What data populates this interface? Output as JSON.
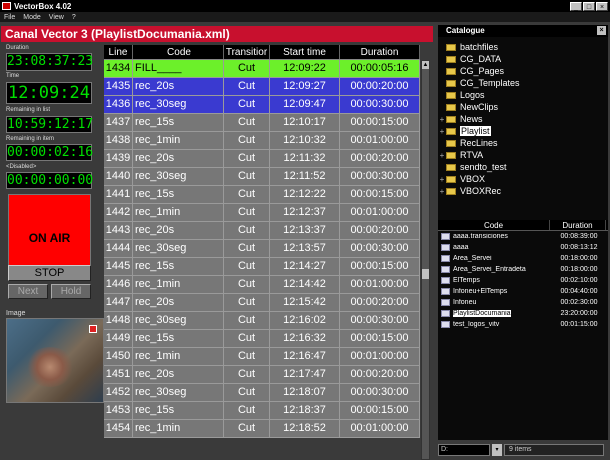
{
  "window": {
    "title": "VectorBox 4.02",
    "min": "_",
    "max": "□",
    "close": "×"
  },
  "menu": [
    "File",
    "Mode",
    "View",
    "?"
  ],
  "left": {
    "duration_label": "Duration",
    "duration": "23:08:37:23",
    "time_label": "Time",
    "time": "12:09:24",
    "remaining_list_label": "Remaining in list",
    "remaining_list": "10:59:12:17",
    "remaining_item_label": "Remaining in item",
    "remaining_item": "00:00:02:16",
    "disabled_label": "<Disabled>",
    "disabled": "00:00:00:00",
    "on_air": "ON AIR",
    "stop": "STOP",
    "next": "Next",
    "hold": "Hold",
    "image_label": "Image"
  },
  "playlist": {
    "title": "Canal Vector 3  (PlaylistDocumania.xml)",
    "columns": [
      "Line",
      "Code",
      "Transitior",
      "Start time",
      "Duration"
    ],
    "rows": [
      {
        "line": "1434",
        "code": "FILL____",
        "trans": "Cut",
        "start": "12:09:22",
        "dur": "00:00:05:16",
        "state": "current"
      },
      {
        "line": "1435",
        "code": "rec_20s",
        "trans": "Cut",
        "start": "12:09:27",
        "dur": "00:00:20:00",
        "state": "sel"
      },
      {
        "line": "1436",
        "code": "rec_30seg",
        "trans": "Cut",
        "start": "12:09:47",
        "dur": "00:00:30:00",
        "state": "sel"
      },
      {
        "line": "1437",
        "code": "rec_15s",
        "trans": "Cut",
        "start": "12:10:17",
        "dur": "00:00:15:00",
        "state": ""
      },
      {
        "line": "1438",
        "code": "rec_1min",
        "trans": "Cut",
        "start": "12:10:32",
        "dur": "00:01:00:00",
        "state": ""
      },
      {
        "line": "1439",
        "code": "rec_20s",
        "trans": "Cut",
        "start": "12:11:32",
        "dur": "00:00:20:00",
        "state": ""
      },
      {
        "line": "1440",
        "code": "rec_30seg",
        "trans": "Cut",
        "start": "12:11:52",
        "dur": "00:00:30:00",
        "state": ""
      },
      {
        "line": "1441",
        "code": "rec_15s",
        "trans": "Cut",
        "start": "12:12:22",
        "dur": "00:00:15:00",
        "state": ""
      },
      {
        "line": "1442",
        "code": "rec_1min",
        "trans": "Cut",
        "start": "12:12:37",
        "dur": "00:01:00:00",
        "state": ""
      },
      {
        "line": "1443",
        "code": "rec_20s",
        "trans": "Cut",
        "start": "12:13:37",
        "dur": "00:00:20:00",
        "state": ""
      },
      {
        "line": "1444",
        "code": "rec_30seg",
        "trans": "Cut",
        "start": "12:13:57",
        "dur": "00:00:30:00",
        "state": ""
      },
      {
        "line": "1445",
        "code": "rec_15s",
        "trans": "Cut",
        "start": "12:14:27",
        "dur": "00:00:15:00",
        "state": ""
      },
      {
        "line": "1446",
        "code": "rec_1min",
        "trans": "Cut",
        "start": "12:14:42",
        "dur": "00:01:00:00",
        "state": ""
      },
      {
        "line": "1447",
        "code": "rec_20s",
        "trans": "Cut",
        "start": "12:15:42",
        "dur": "00:00:20:00",
        "state": ""
      },
      {
        "line": "1448",
        "code": "rec_30seg",
        "trans": "Cut",
        "start": "12:16:02",
        "dur": "00:00:30:00",
        "state": ""
      },
      {
        "line": "1449",
        "code": "rec_15s",
        "trans": "Cut",
        "start": "12:16:32",
        "dur": "00:00:15:00",
        "state": ""
      },
      {
        "line": "1450",
        "code": "rec_1min",
        "trans": "Cut",
        "start": "12:16:47",
        "dur": "00:01:00:00",
        "state": ""
      },
      {
        "line": "1451",
        "code": "rec_20s",
        "trans": "Cut",
        "start": "12:17:47",
        "dur": "00:00:20:00",
        "state": ""
      },
      {
        "line": "1452",
        "code": "rec_30seg",
        "trans": "Cut",
        "start": "12:18:07",
        "dur": "00:00:30:00",
        "state": ""
      },
      {
        "line": "1453",
        "code": "rec_15s",
        "trans": "Cut",
        "start": "12:18:37",
        "dur": "00:00:15:00",
        "state": ""
      },
      {
        "line": "1454",
        "code": "rec_1min",
        "trans": "Cut",
        "start": "12:18:52",
        "dur": "00:01:00:00",
        "state": ""
      }
    ]
  },
  "catalogue": {
    "title": "Catalogue",
    "close": "×",
    "tree": [
      {
        "label": "batchfiles",
        "exp": ""
      },
      {
        "label": "CG_DATA",
        "exp": ""
      },
      {
        "label": "CG_Pages",
        "exp": ""
      },
      {
        "label": "CG_Templates",
        "exp": ""
      },
      {
        "label": "Logos",
        "exp": ""
      },
      {
        "label": "NewClips",
        "exp": ""
      },
      {
        "label": "News",
        "exp": "+"
      },
      {
        "label": "Playlist",
        "exp": "+",
        "sel": true
      },
      {
        "label": "RecLines",
        "exp": ""
      },
      {
        "label": "RTVA",
        "exp": "+"
      },
      {
        "label": "sendto_test",
        "exp": ""
      },
      {
        "label": "VBOX",
        "exp": "+"
      },
      {
        "label": "VBOXRec",
        "exp": "+"
      }
    ],
    "list_columns": [
      "Code",
      "Duration"
    ],
    "list": [
      {
        "code": "aaaa.transiciones",
        "dur": "00:08:39:00"
      },
      {
        "code": "aaaa",
        "dur": "00:08:13:12"
      },
      {
        "code": "Area_Servei",
        "dur": "00:18:00:00"
      },
      {
        "code": "Area_Servei_Entradeta",
        "dur": "00:18:00:00"
      },
      {
        "code": "ElTemps",
        "dur": "00:02:10:00"
      },
      {
        "code": "Infoneu+ElTemps",
        "dur": "00:04:40:00"
      },
      {
        "code": "Infoneu",
        "dur": "00:02:30:00"
      },
      {
        "code": "PlaylistDocumania",
        "dur": "23:20:00:00",
        "hl": true
      },
      {
        "code": "test_logos_vitv",
        "dur": "00:01:15:00"
      }
    ],
    "drive": "D:",
    "drive_btn": "▾",
    "items": "9 items"
  }
}
